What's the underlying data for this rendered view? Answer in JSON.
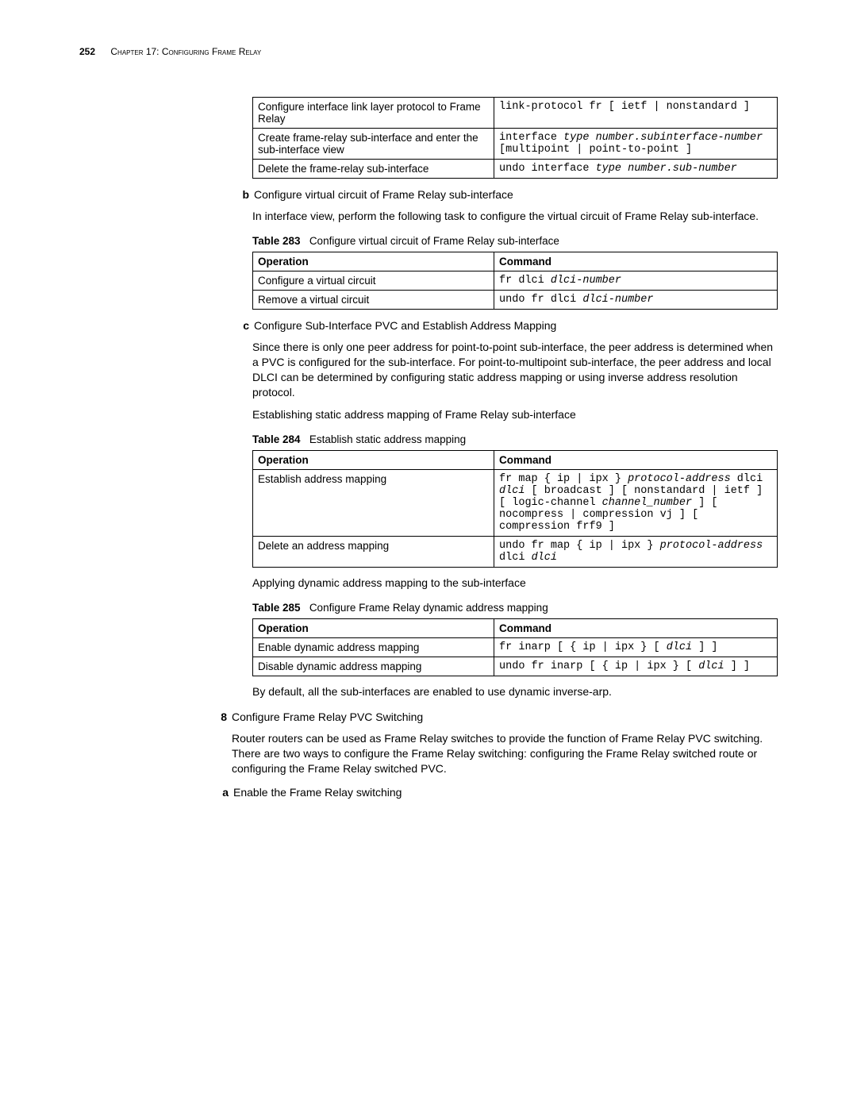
{
  "header": {
    "page_number": "252",
    "chapter_label": "Chapter 17: Configuring Frame Relay"
  },
  "table_top": {
    "rows": [
      {
        "op": "Configure interface link layer protocol to Frame Relay",
        "cmd": "link-protocol fr [ ietf | nonstandard ]"
      },
      {
        "op": "Create frame-relay sub-interface and enter the sub-interface view",
        "cmd_parts": [
          "interface ",
          "type",
          " ",
          "number.subinterface-number",
          " [multipoint | point-to-point ]"
        ]
      },
      {
        "op": "Delete the frame-relay sub-interface",
        "cmd_parts": [
          "undo interface ",
          "type",
          " ",
          "number.sub-number"
        ]
      }
    ]
  },
  "section_b": {
    "marker": "b",
    "heading": "Configure virtual circuit of Frame Relay sub-interface",
    "para": "In interface view, perform the following task to configure the virtual circuit of Frame Relay sub-interface.",
    "caption_bold": "Table 283",
    "caption_rest": "Configure virtual circuit of Frame Relay sub-interface",
    "th1": "Operation",
    "th2": "Command",
    "rows": [
      {
        "op": "Configure a virtual circuit",
        "cmd_plain": "fr dlci ",
        "cmd_em": "dlci-number"
      },
      {
        "op": "Remove a virtual circuit",
        "cmd_plain": "undo fr dlci ",
        "cmd_em": "dlci-number"
      }
    ]
  },
  "section_c": {
    "marker": "c",
    "heading": "Configure Sub-Interface PVC and Establish Address Mapping",
    "para1": "Since there is only one peer address for point-to-point sub-interface, the peer address is determined when a PVC is configured for the sub-interface. For point-to-multipoint sub-interface, the peer address and local DLCI can be determined by configuring static address mapping or using inverse address resolution protocol.",
    "para2": "Establishing static address mapping of Frame Relay sub-interface",
    "caption_bold": "Table 284",
    "caption_rest": "Establish static address mapping",
    "th1": "Operation",
    "th2": "Command",
    "rows": [
      {
        "op": "Establish address mapping",
        "cmd_html": "fr map { ip | ipx } <i>protocol-address</i> dlci <i>dlci</i> [ broadcast ] [ nonstandard | ietf ] [ logic-channel <i>channel_number</i> ] [ nocompress | compression vj ] [ compression frf9 ]"
      },
      {
        "op": "Delete an address mapping",
        "cmd_html": "undo fr map { ip | ipx } <i>protocol-address</i> dlci <i>dlci</i>"
      }
    ],
    "para3": "Applying dynamic address mapping to the sub-interface",
    "caption2_bold": "Table 285",
    "caption2_rest": "Configure Frame Relay dynamic address mapping",
    "rows2": [
      {
        "op": "Enable dynamic address mapping",
        "cmd_html": "fr inarp [ { ip | ipx } [ <i>dlci</i> ] ]"
      },
      {
        "op": "Disable dynamic address mapping",
        "cmd_html": "undo fr inarp [ { ip | ipx } [ <i>dlci</i> ] ]"
      }
    ],
    "para4": "By default, all the sub-interfaces are enabled to use dynamic inverse-arp."
  },
  "section_8": {
    "marker": "8",
    "heading": "Configure Frame Relay PVC Switching",
    "para": "Router routers can be used as Frame Relay switches to provide the function of Frame Relay PVC switching. There are two ways to configure the Frame Relay switching: configuring the Frame Relay switched route or configuring the Frame Relay switched PVC.",
    "sub_a_marker": "a",
    "sub_a_text": "Enable the Frame Relay switching"
  }
}
